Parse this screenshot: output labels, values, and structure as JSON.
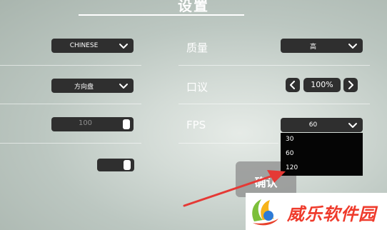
{
  "title": "设置",
  "left_settings": {
    "language_value": "CHINESE",
    "control_value": "方向盘",
    "slider_value": "100",
    "toggle_on": true
  },
  "right_settings": {
    "quality_label": "质量",
    "quality_value": "高",
    "zoom_label": "口议",
    "zoom_value": "100%",
    "fps_label": "FPS",
    "fps_value": "60",
    "fps_options": [
      "30",
      "60",
      "120"
    ]
  },
  "confirm_label": "确认",
  "watermark_text": "威乐软件园",
  "colors": {
    "control_bg": "#2f2f2f",
    "dropdown_menu_bg": "#050505",
    "arrow": "#e53935",
    "watermark_text": "#ef3b2c"
  }
}
